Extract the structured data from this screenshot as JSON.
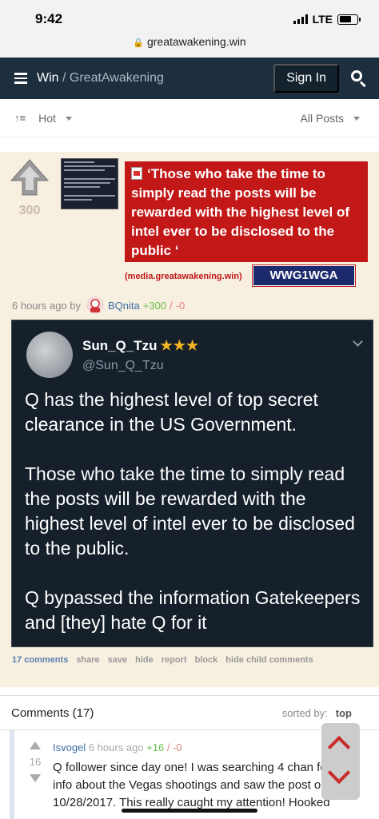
{
  "status": {
    "time": "9:42",
    "network": "LTE"
  },
  "browser": {
    "url": "greatawakening.win"
  },
  "nav": {
    "site": "Win",
    "separator": " / ",
    "community": "GreatAwakening",
    "sign_in": "Sign In"
  },
  "sort": {
    "order": "Hot",
    "filter": "All Posts"
  },
  "post": {
    "score": "300",
    "title": "‘Those who take the time to simply read the posts will be rewarded with the highest level of intel ever to be disclosed to the public ‘",
    "domain": "(media.greatawakening.win)",
    "flair": "WWG1WGA",
    "age": "6 hours ago by",
    "author": "BQnita",
    "upvotes": "+300",
    "separator": "/",
    "downvotes": "-0",
    "tweet": {
      "name": "Sun_Q_Tzu",
      "stars": "★★★",
      "handle": "@Sun_Q_Tzu",
      "text": "Q has the highest level of top secret clearance in the US Government.\n\nThose who take the time to simply read the posts will be rewarded with the highest level of intel ever to be disclosed to the public.\n\nQ bypassed the information Gatekeepers and [they] hate Q for it"
    },
    "actions": {
      "comments": "17 comments",
      "share": "share",
      "save": "save",
      "hide": "hide",
      "report": "report",
      "block": "block",
      "hide_child": "hide child comments"
    }
  },
  "comments": {
    "title": "Comments (17)",
    "sorted_by_label": "sorted by:",
    "sorted_by_value": "top",
    "items": [
      {
        "score": "16",
        "author": "Isvogel",
        "age": "6 hours ago",
        "upvotes": "+16",
        "separator": "/",
        "downvotes": "-0",
        "text": "Q follower since day one! I was searching 4 chan for info about the Vegas shootings and saw the post on 10/28/2017. This really caught my attention! Hooked"
      }
    ]
  },
  "colors": {
    "nav_bg": "#1d2f3f",
    "post_bg": "#f7efe0",
    "title_red": "#c31818",
    "tweet_bg": "#15202b",
    "link_blue": "#3a6ea5"
  }
}
